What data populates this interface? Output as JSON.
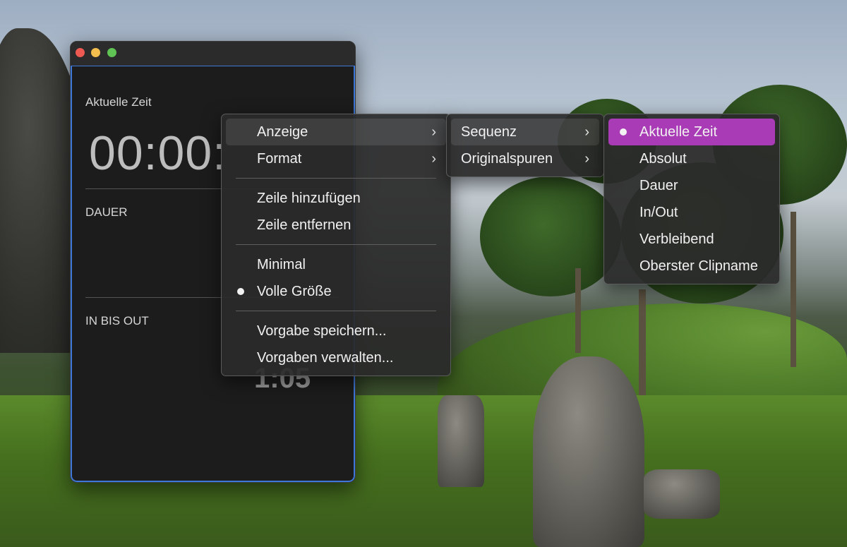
{
  "window": {
    "labels": {
      "current_time": "Aktuelle Zeit",
      "duration": "DAUER",
      "in_out": "IN BIS OUT"
    },
    "timecode": "00:00:",
    "partial_value": "1:05"
  },
  "menu_main": {
    "items": [
      {
        "label": "Anzeige",
        "submenu": true,
        "highlighted": true
      },
      {
        "label": "Format",
        "submenu": true
      },
      {
        "label": "Zeile hinzufügen"
      },
      {
        "label": "Zeile entfernen"
      },
      {
        "label": "Minimal"
      },
      {
        "label": "Volle Größe",
        "checked": true
      },
      {
        "label": "Vorgabe speichern..."
      },
      {
        "label": "Vorgaben verwalten..."
      }
    ]
  },
  "menu_sequenz": {
    "items": [
      {
        "label": "Sequenz",
        "submenu": true,
        "highlighted": true
      },
      {
        "label": "Originalspuren",
        "submenu": true
      }
    ]
  },
  "menu_display_mode": {
    "items": [
      {
        "label": "Aktuelle Zeit",
        "checked": true,
        "selected": true
      },
      {
        "label": "Absolut"
      },
      {
        "label": "Dauer"
      },
      {
        "label": "In/Out"
      },
      {
        "label": "Verbleibend"
      },
      {
        "label": "Oberster Clipname"
      }
    ]
  },
  "icons": {
    "chevron": "chevron-right-icon",
    "bullet": "bullet-icon"
  },
  "colors": {
    "selection": "#a93cb6",
    "focus_border": "#3d78d8",
    "close": "#ee5a52",
    "minimize": "#f4be4f",
    "zoom": "#5fc454"
  }
}
